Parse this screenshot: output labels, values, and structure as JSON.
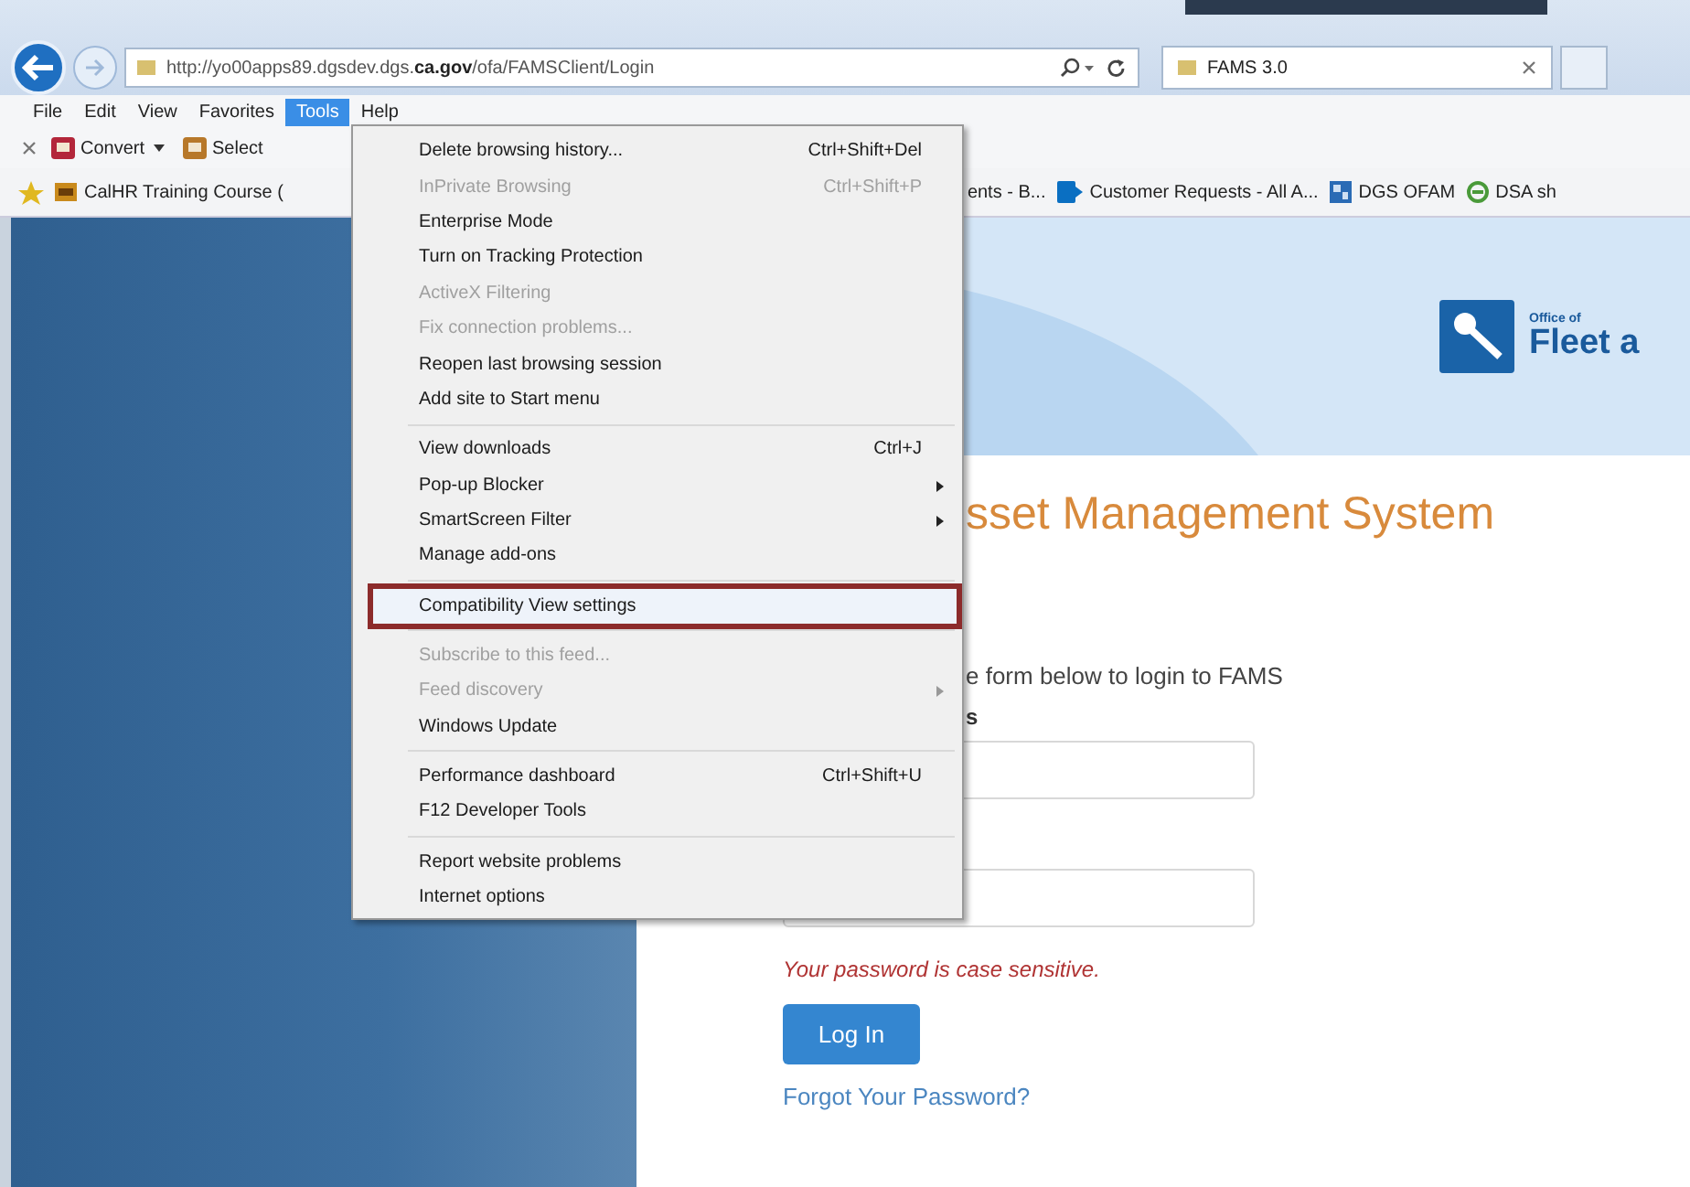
{
  "browser": {
    "url": "http://yo00apps89.dgsdev.dgs.**ca.gov**/ofa/FAMSClient/Login",
    "tab": {
      "title": "FAMS 3.0",
      "selected": true
    }
  },
  "menu_bar": [
    {
      "label": "File",
      "selected": false
    },
    {
      "label": "Edit",
      "selected": false
    },
    {
      "label": "View",
      "selected": false
    },
    {
      "label": "Favorites",
      "selected": false
    },
    {
      "label": "Tools",
      "selected": true
    },
    {
      "label": "Help",
      "selected": false
    }
  ],
  "command_bar": [
    {
      "label": "Convert",
      "dropdown": true
    },
    {
      "label": "Select",
      "dropdown": false
    }
  ],
  "favorites": [
    {
      "label": "CalHR Training Course (",
      "kind": "hr"
    },
    {
      "label": "ents - B...",
      "kind": "none"
    },
    {
      "label": "Customer Requests - All A...",
      "kind": "sharepoint"
    },
    {
      "label": "DGS OFAM",
      "kind": "tile"
    },
    {
      "label": "DSA sh",
      "kind": "ie"
    }
  ],
  "tools_menu": {
    "groups": [
      [
        {
          "label": "Delete browsing history...",
          "shortcut": "Ctrl+Shift+Del",
          "disabled": false,
          "submenu": false,
          "highlighted": false
        },
        {
          "label": "InPrivate Browsing",
          "shortcut": "Ctrl+Shift+P",
          "disabled": true,
          "submenu": false,
          "highlighted": false
        },
        {
          "label": "Enterprise Mode",
          "disabled": false,
          "submenu": false,
          "highlighted": false
        },
        {
          "label": "Turn on Tracking Protection",
          "disabled": false,
          "submenu": false,
          "highlighted": false
        },
        {
          "label": "ActiveX Filtering",
          "disabled": true,
          "submenu": false,
          "highlighted": false
        },
        {
          "label": "Fix connection problems...",
          "disabled": true,
          "submenu": false,
          "highlighted": false
        },
        {
          "label": "Reopen last browsing session",
          "disabled": false,
          "submenu": false,
          "highlighted": false
        },
        {
          "label": "Add site to Start menu",
          "disabled": false,
          "submenu": false,
          "highlighted": false
        }
      ],
      [
        {
          "label": "View downloads",
          "shortcut": "Ctrl+J",
          "disabled": false,
          "submenu": false,
          "highlighted": false
        },
        {
          "label": "Pop-up Blocker",
          "disabled": false,
          "submenu": true,
          "highlighted": false
        },
        {
          "label": "SmartScreen Filter",
          "disabled": false,
          "submenu": true,
          "highlighted": false
        },
        {
          "label": "Manage add-ons",
          "disabled": false,
          "submenu": false,
          "highlighted": false
        }
      ],
      [
        {
          "label": "Compatibility View settings",
          "disabled": false,
          "submenu": false,
          "highlighted": true
        }
      ],
      [
        {
          "label": "Subscribe to this feed...",
          "disabled": true,
          "submenu": false,
          "highlighted": false
        },
        {
          "label": "Feed discovery",
          "disabled": true,
          "submenu": true,
          "highlighted": false
        },
        {
          "label": "Windows Update",
          "disabled": false,
          "submenu": false,
          "highlighted": false
        }
      ],
      [
        {
          "label": "Performance dashboard",
          "shortcut": "Ctrl+Shift+U",
          "disabled": false,
          "submenu": false,
          "highlighted": false
        },
        {
          "label": "F12 Developer Tools",
          "disabled": false,
          "submenu": false,
          "highlighted": false
        }
      ],
      [
        {
          "label": "Report website problems",
          "disabled": false,
          "submenu": false,
          "highlighted": false
        },
        {
          "label": "Internet options",
          "disabled": false,
          "submenu": false,
          "highlighted": false
        }
      ]
    ]
  },
  "page": {
    "logo": {
      "line_1": "Office of",
      "line_2": "Fleet a"
    },
    "title": "sset Management System",
    "instructions": "e form below to login to FAMS",
    "field_label": "s",
    "note": "Your password is case sensitive.",
    "login_button": "Log In",
    "forgot_link": "Forgot Your Password?"
  }
}
